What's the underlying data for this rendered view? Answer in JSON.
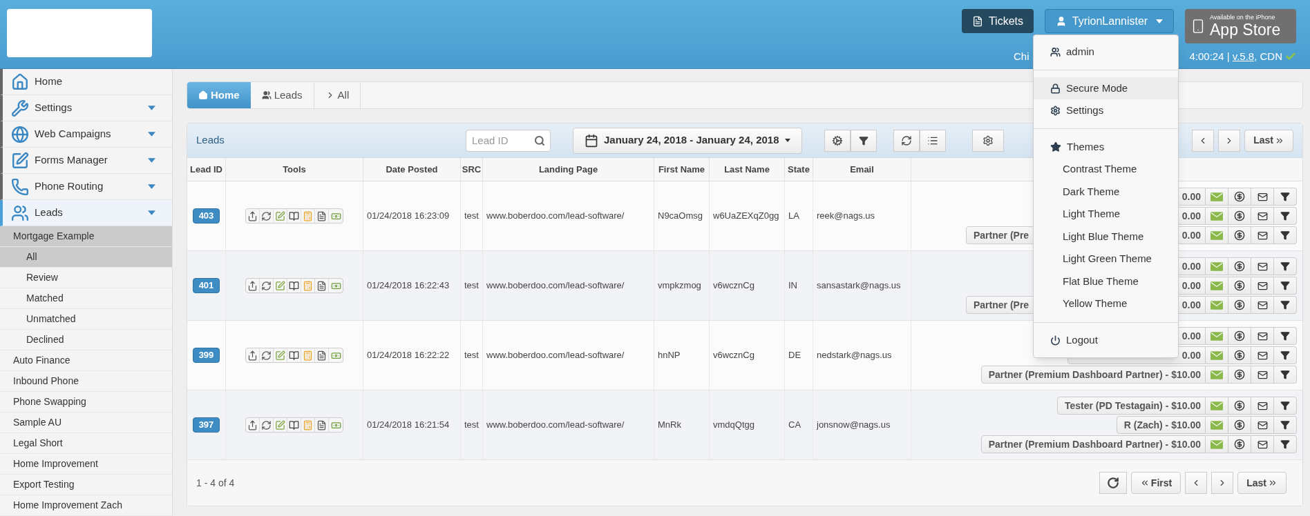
{
  "header": {
    "tickets_button": "Tickets",
    "user_button": "TyrionLannister",
    "status_left": "Chi",
    "status_right": "4:00:24 | ",
    "version_link": "v.5.8",
    "cdn": ", CDN",
    "cdn_ok": true,
    "app_store": {
      "small": "Available on the iPhone",
      "big": "App Store"
    }
  },
  "user_menu": [
    {
      "kind": "item",
      "label": "admin",
      "selected": false
    },
    {
      "kind": "divider"
    },
    {
      "kind": "item",
      "label": "Secure Mode",
      "selected": true
    },
    {
      "kind": "item",
      "label": "Settings",
      "selected": false
    },
    {
      "kind": "divider"
    },
    {
      "kind": "header",
      "label": "Themes"
    },
    {
      "kind": "theme",
      "label": "Contrast Theme"
    },
    {
      "kind": "theme",
      "label": "Dark Theme"
    },
    {
      "kind": "theme",
      "label": "Light Theme"
    },
    {
      "kind": "theme",
      "label": "Light Blue Theme"
    },
    {
      "kind": "theme",
      "label": "Light Green Theme"
    },
    {
      "kind": "theme",
      "label": "Flat Blue Theme"
    },
    {
      "kind": "theme",
      "label": "Yellow Theme"
    },
    {
      "kind": "divider"
    },
    {
      "kind": "item",
      "label": "Logout",
      "selected": false
    }
  ],
  "sidebar": {
    "items": [
      {
        "label": "Home",
        "has_submenu": false,
        "selected": false
      },
      {
        "label": "Settings",
        "has_submenu": true,
        "selected": false
      },
      {
        "label": "Web Campaigns",
        "has_submenu": true,
        "selected": false
      },
      {
        "label": "Forms Manager",
        "has_submenu": true,
        "selected": false
      },
      {
        "label": "Phone Routing",
        "has_submenu": true,
        "selected": false
      },
      {
        "label": "Leads",
        "has_submenu": true,
        "selected": true,
        "children": [
          {
            "label": "Mortgage Example",
            "expanded": true,
            "children": [
              {
                "label": "All",
                "selected": true
              },
              {
                "label": "Review",
                "selected": false
              },
              {
                "label": "Matched",
                "selected": false
              },
              {
                "label": "Unmatched",
                "selected": false
              },
              {
                "label": "Declined",
                "selected": false
              }
            ]
          },
          {
            "label": "Auto Finance",
            "expanded": false
          },
          {
            "label": "Inbound Phone",
            "expanded": false
          },
          {
            "label": "Phone Swapping",
            "expanded": false
          },
          {
            "label": "Sample AU",
            "expanded": false
          },
          {
            "label": "Legal Short",
            "expanded": false
          },
          {
            "label": "Home Improvement",
            "expanded": false
          },
          {
            "label": "Export Testing",
            "expanded": false
          },
          {
            "label": "Home Improvement Zach",
            "expanded": false
          }
        ]
      }
    ]
  },
  "breadcrumb": [
    {
      "label": "Home",
      "selected": true
    },
    {
      "label": "Leads",
      "selected": false
    },
    {
      "label": "All",
      "selected": false
    }
  ],
  "panel": {
    "title": "Leads",
    "search": {
      "placeholder": "Lead ID"
    },
    "date_range": "January 24, 2018 - January 24, 2018",
    "pager": [
      "Last"
    ],
    "columns": [
      "Lead ID",
      "Tools",
      "Date Posted",
      "SRC",
      "Landing Page",
      "First Name",
      "Last Name",
      "State",
      "Email"
    ],
    "rows": [
      {
        "lead_id": "403",
        "date": "01/24/2018 16:23:09",
        "src": "test",
        "landing": "www.boberdoo.com/lead-software/",
        "first": "N9caOmsg",
        "last": "w6UaZEXqZ0gg",
        "state": "LA",
        "email": "reek@nags.us",
        "partners": [
          {
            "price": "0.00"
          },
          {
            "price": "0.00"
          },
          {
            "name": "Partner (Pre",
            "price": "0.00"
          }
        ]
      },
      {
        "lead_id": "401",
        "date": "01/24/2018 16:22:43",
        "src": "test",
        "landing": "www.boberdoo.com/lead-software/",
        "first": "vmpkzmog",
        "last": "v6wcznCg",
        "state": "IN",
        "email": "sansastark@nags.us",
        "partners": [
          {
            "price": "0.00"
          },
          {
            "price": "0.00"
          },
          {
            "name": "Partner (Pre",
            "price": "0.00"
          }
        ]
      },
      {
        "lead_id": "399",
        "date": "01/24/2018 16:22:22",
        "src": "test",
        "landing": "www.boberdoo.com/lead-software/",
        "first": "hnNP",
        "last": "v6wcznCg",
        "state": "DE",
        "email": "nedstark@nags.us",
        "partners": [
          {
            "price": "0.00"
          },
          {
            "price": "0.00"
          },
          {
            "label": "Partner (Premium Dashboard Partner) - $10.00"
          }
        ]
      },
      {
        "lead_id": "397",
        "date": "01/24/2018 16:21:54",
        "src": "test",
        "landing": "www.boberdoo.com/lead-software/",
        "first": "MnRk",
        "last": "vmdqQtgg",
        "state": "CA",
        "email": "jonsnow@nags.us",
        "partners": [
          {
            "label": "Tester (PD Testagain) - $10.00"
          },
          {
            "label": "R (Zach) - $10.00"
          },
          {
            "label": "Partner (Premium Dashboard Partner) - $10.00"
          }
        ]
      }
    ],
    "footer": {
      "count": "1 - 4 of 4",
      "first": "First",
      "last": "Last"
    }
  }
}
